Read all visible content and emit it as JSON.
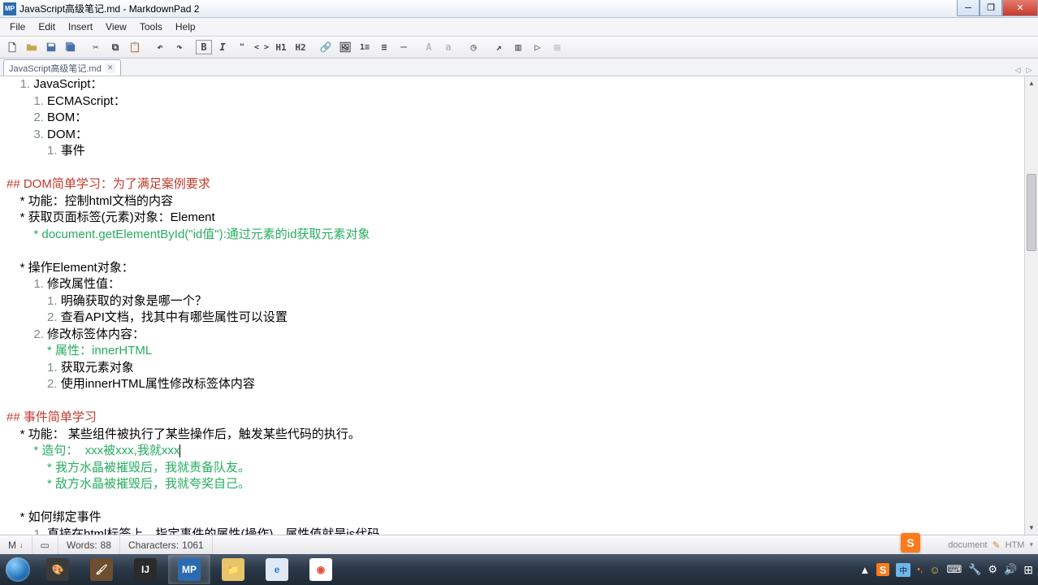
{
  "window": {
    "title": "JavaScript高级笔记.md - MarkdownPad 2"
  },
  "menu": [
    "File",
    "Edit",
    "Insert",
    "View",
    "Tools",
    "Help"
  ],
  "toolbar_labels": {
    "h1": "H1",
    "h2": "H2",
    "bold": "B",
    "italic": "I",
    "quote": "❝",
    "code": "< >",
    "link": "🔗",
    "image": "🖼",
    "ol": "1≡",
    "ul": "≡",
    "a_upper": "A",
    "a_lower": "a",
    "time": "◷",
    "out": "↗",
    "cols": "▥",
    "run": "▷"
  },
  "tab": {
    "label": "JavaScript高级笔记.md"
  },
  "editor": {
    "lines": [
      {
        "t": "num",
        "indent": "    ",
        "pre": "1. ",
        "txt": "JavaScript："
      },
      {
        "t": "num",
        "indent": "        ",
        "pre": "1. ",
        "txt": "ECMAScript："
      },
      {
        "t": "num",
        "indent": "        ",
        "pre": "2. ",
        "txt": "BOM："
      },
      {
        "t": "num",
        "indent": "        ",
        "pre": "3. ",
        "txt": "DOM："
      },
      {
        "t": "num",
        "indent": "            ",
        "pre": "1. ",
        "txt": "事件"
      },
      {
        "t": "blank"
      },
      {
        "t": "h2",
        "txt": "## DOM简单学习：为了满足案例要求"
      },
      {
        "t": "li",
        "indent": "    ",
        "txt": "* 功能：控制html文档的内容"
      },
      {
        "t": "li",
        "indent": "    ",
        "txt": "* 获取页面标签(元素)对象：Element"
      },
      {
        "t": "grn",
        "indent": "        ",
        "txt": "* document.getElementById(\"id值\"):通过元素的id获取元素对象"
      },
      {
        "t": "blank"
      },
      {
        "t": "li",
        "indent": "    ",
        "txt": "* 操作Element对象："
      },
      {
        "t": "num",
        "indent": "        ",
        "pre": "1. ",
        "txt": "修改属性值："
      },
      {
        "t": "num",
        "indent": "            ",
        "pre": "1. ",
        "txt": "明确获取的对象是哪一个？"
      },
      {
        "t": "num",
        "indent": "            ",
        "pre": "2. ",
        "txt": "查看API文档，找其中有哪些属性可以设置"
      },
      {
        "t": "num",
        "indent": "        ",
        "pre": "2. ",
        "txt": "修改标签体内容："
      },
      {
        "t": "grn",
        "indent": "            ",
        "txt": "* 属性：innerHTML"
      },
      {
        "t": "num",
        "indent": "            ",
        "pre": "1. ",
        "txt": "获取元素对象"
      },
      {
        "t": "num",
        "indent": "            ",
        "pre": "2. ",
        "txt": "使用innerHTML属性修改标签体内容"
      },
      {
        "t": "blank"
      },
      {
        "t": "h2",
        "txt": "## 事件简单学习"
      },
      {
        "t": "li",
        "indent": "    ",
        "txt": "* 功能： 某些组件被执行了某些操作后，触发某些代码的执行。"
      },
      {
        "t": "grn",
        "indent": "        ",
        "txt": "* 造句：  xxx被xxx,我就xxx",
        "caret": true,
        "caret_at": 22
      },
      {
        "t": "grn",
        "indent": "            ",
        "txt": "* 我方水晶被摧毁后，我就责备队友。"
      },
      {
        "t": "grn",
        "indent": "            ",
        "txt": "* 敌方水晶被摧毁后，我就夸奖自己。"
      },
      {
        "t": "blank"
      },
      {
        "t": "li",
        "indent": "    ",
        "txt": "* 如何绑定事件"
      },
      {
        "t": "num",
        "indent": "        ",
        "pre": "1. ",
        "txt": "直接在html标签上，指定事件的属性(操作)，属性值就是js代码"
      }
    ]
  },
  "status": {
    "words_label": "Words:",
    "words": "88",
    "chars_label": "Characters:",
    "chars": "1061",
    "right_doc": "document",
    "right_htm": "HTM"
  },
  "sogou": "S",
  "taskbar": {
    "items": [
      {
        "name": "paint",
        "bg": "#3b3b3b",
        "label": "🎨"
      },
      {
        "name": "brush",
        "bg": "#6d4e2f",
        "label": "🖌"
      },
      {
        "name": "intellij",
        "bg": "#2b2b2b",
        "label": "IJ"
      },
      {
        "name": "markdownpad",
        "bg": "#2b6cb0",
        "label": "MP",
        "active": true
      },
      {
        "name": "explorer",
        "bg": "#e8c46a",
        "label": "📁"
      },
      {
        "name": "ie",
        "bg": "#dfeaf5",
        "label": "e",
        "fg": "#2a7ad1"
      },
      {
        "name": "chrome",
        "bg": "#ffffff",
        "label": "◉",
        "fg": "#e04f3b"
      }
    ]
  },
  "tray": {
    "sogou": "S",
    "bubble": "中",
    "smile": "☺",
    "gear": "⚙",
    "up": "▲"
  }
}
